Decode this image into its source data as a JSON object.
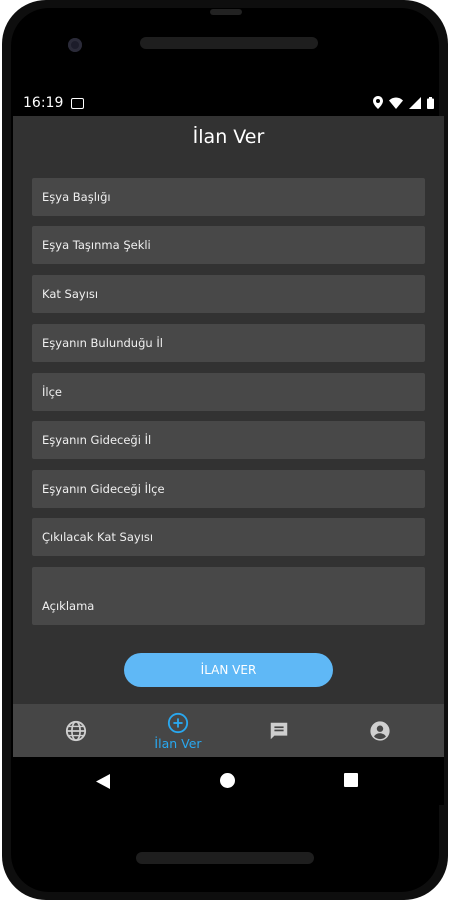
{
  "status_bar": {
    "time": "16:19"
  },
  "header": {
    "title": "İlan Ver"
  },
  "form": {
    "fields": [
      "Eşya Başlığı",
      "Eşya Taşınma Şekli",
      "Kat Sayısı",
      "Eşyanın Bulunduğu İl",
      "İlçe",
      "Eşyanın Gideceği İl",
      "Eşyanın Gideceği İlçe",
      "Çıkılacak Kat Sayısı"
    ],
    "description_label": "Açıklama",
    "submit_label": "İLAN VER"
  },
  "bottom_nav": {
    "items": [
      {
        "icon": "globe-icon",
        "label": ""
      },
      {
        "icon": "add-circle-icon",
        "label": "İlan Ver",
        "active": true
      },
      {
        "icon": "chat-icon",
        "label": ""
      },
      {
        "icon": "account-icon",
        "label": ""
      }
    ]
  },
  "colors": {
    "background": "#323232",
    "field": "#484848",
    "accent": "#29a8f0",
    "button": "#5fb8f6",
    "nav": "#464646"
  }
}
